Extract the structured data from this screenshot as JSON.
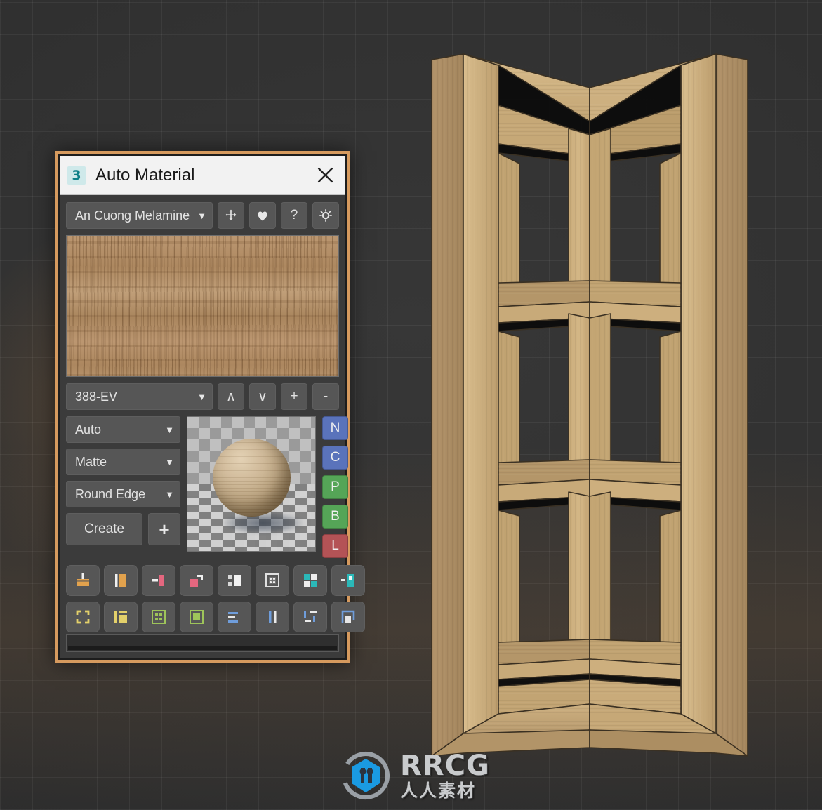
{
  "viewport": {
    "name": "3d-viewport",
    "background_color": "#313131",
    "grid_color": "#4a4a4a",
    "glow_color": "#d68a3e"
  },
  "model": {
    "name": "corner-shelf-unit",
    "wood_light": "#d8bb8a",
    "wood_mid": "#c4a677",
    "wood_dark": "#b09263",
    "wood_shadow": "#9c7f53",
    "edge_color": "#3a3022"
  },
  "dialog": {
    "title": "Auto Material",
    "app_icon": "3dsmax-icon",
    "close_icon": "close-icon",
    "border_color": "#d69a5e",
    "titlebar_bg": "#f2f2f2",
    "body_bg": "#3b3b3b"
  },
  "library": {
    "selected": "An Cuong Melamine",
    "caret": "▼",
    "buttons": [
      {
        "name": "move-button",
        "icon": "move-cross-icon",
        "label": ""
      },
      {
        "name": "favorite-button",
        "icon": "heart-icon",
        "label": ""
      },
      {
        "name": "help-button",
        "icon": "question-icon",
        "label": "?"
      },
      {
        "name": "settings-button",
        "icon": "gear-icon",
        "label": ""
      }
    ]
  },
  "texture": {
    "name": "wood-texture-preview",
    "description": "horizontal oak melamine wood grain"
  },
  "variant": {
    "selected": "388-EV",
    "caret": "▼",
    "buttons": [
      {
        "name": "prev-button",
        "label": "∧"
      },
      {
        "name": "next-button",
        "label": "∨"
      },
      {
        "name": "add-button",
        "label": "+"
      },
      {
        "name": "remove-button",
        "label": "-"
      }
    ]
  },
  "options": {
    "mapping": {
      "label": "Auto",
      "caret": "▼"
    },
    "finish": {
      "label": "Matte",
      "caret": "▼"
    },
    "edge": {
      "label": "Round Edge",
      "caret": "▼"
    },
    "create_label": "Create",
    "add_label": "+"
  },
  "preview": {
    "name": "material-sphere-preview",
    "description": "wood material sphere on checkerboard"
  },
  "channels": [
    {
      "key": "N",
      "name": "channel-normal",
      "color": "#5a73bb"
    },
    {
      "key": "C",
      "name": "channel-color",
      "color": "#5a73bb"
    },
    {
      "key": "P",
      "name": "channel-physical",
      "color": "#55a557"
    },
    {
      "key": "B",
      "name": "channel-bump",
      "color": "#55a557"
    },
    {
      "key": "L",
      "name": "channel-light",
      "color": "#b45356"
    }
  ],
  "tools_row1": [
    {
      "name": "apply-to-floor-tool",
      "icon": "floor-plane-icon",
      "color": "#e2a24d"
    },
    {
      "name": "apply-to-panel-tool",
      "icon": "vertical-panel-icon",
      "color": "#e2a24d"
    },
    {
      "name": "apply-to-edge-tool",
      "icon": "edge-strip-icon",
      "color": "#e4677f"
    },
    {
      "name": "corner-join-tool",
      "icon": "corner-join-icon",
      "color": "#e4677f"
    },
    {
      "name": "split-face-tool",
      "icon": "split-face-icon",
      "color": "#d8d8d8"
    },
    {
      "name": "checker-map-tool",
      "icon": "checker-map-icon",
      "color": "#d8d8d8"
    },
    {
      "name": "quad-tiles-tool",
      "icon": "quad-tiles-icon",
      "color": "#2bb8b8"
    },
    {
      "name": "side-panel-tool",
      "icon": "side-panel-icon",
      "color": "#2bb8b8"
    }
  ],
  "tools_row2": [
    {
      "name": "select-bounds-tool",
      "icon": "select-brackets-icon",
      "color": "#e3d06a"
    },
    {
      "name": "layout-left-tool",
      "icon": "layout-left-icon",
      "color": "#e3d06a"
    },
    {
      "name": "grid-cells-tool",
      "icon": "grid-cells-icon",
      "color": "#9ec45a"
    },
    {
      "name": "fill-square-tool",
      "icon": "fill-square-icon",
      "color": "#9ec45a"
    },
    {
      "name": "align-rows-tool",
      "icon": "align-rows-icon",
      "color": "#6f9ddb"
    },
    {
      "name": "two-columns-tool",
      "icon": "two-columns-icon",
      "color": "#6f9ddb"
    },
    {
      "name": "scatter-bars-tool",
      "icon": "scatter-bars-icon",
      "color": "#6f9ddb"
    },
    {
      "name": "corner-frame-tool",
      "icon": "corner-frame-icon",
      "color": "#6f9ddb"
    }
  ],
  "status": {
    "name": "progress-bar",
    "value": 0
  },
  "watermark": {
    "logo": "rrcg-logo-icon",
    "text_en": "RRCG",
    "text_cn": "人人素材",
    "accent": "#1a9ae2"
  }
}
